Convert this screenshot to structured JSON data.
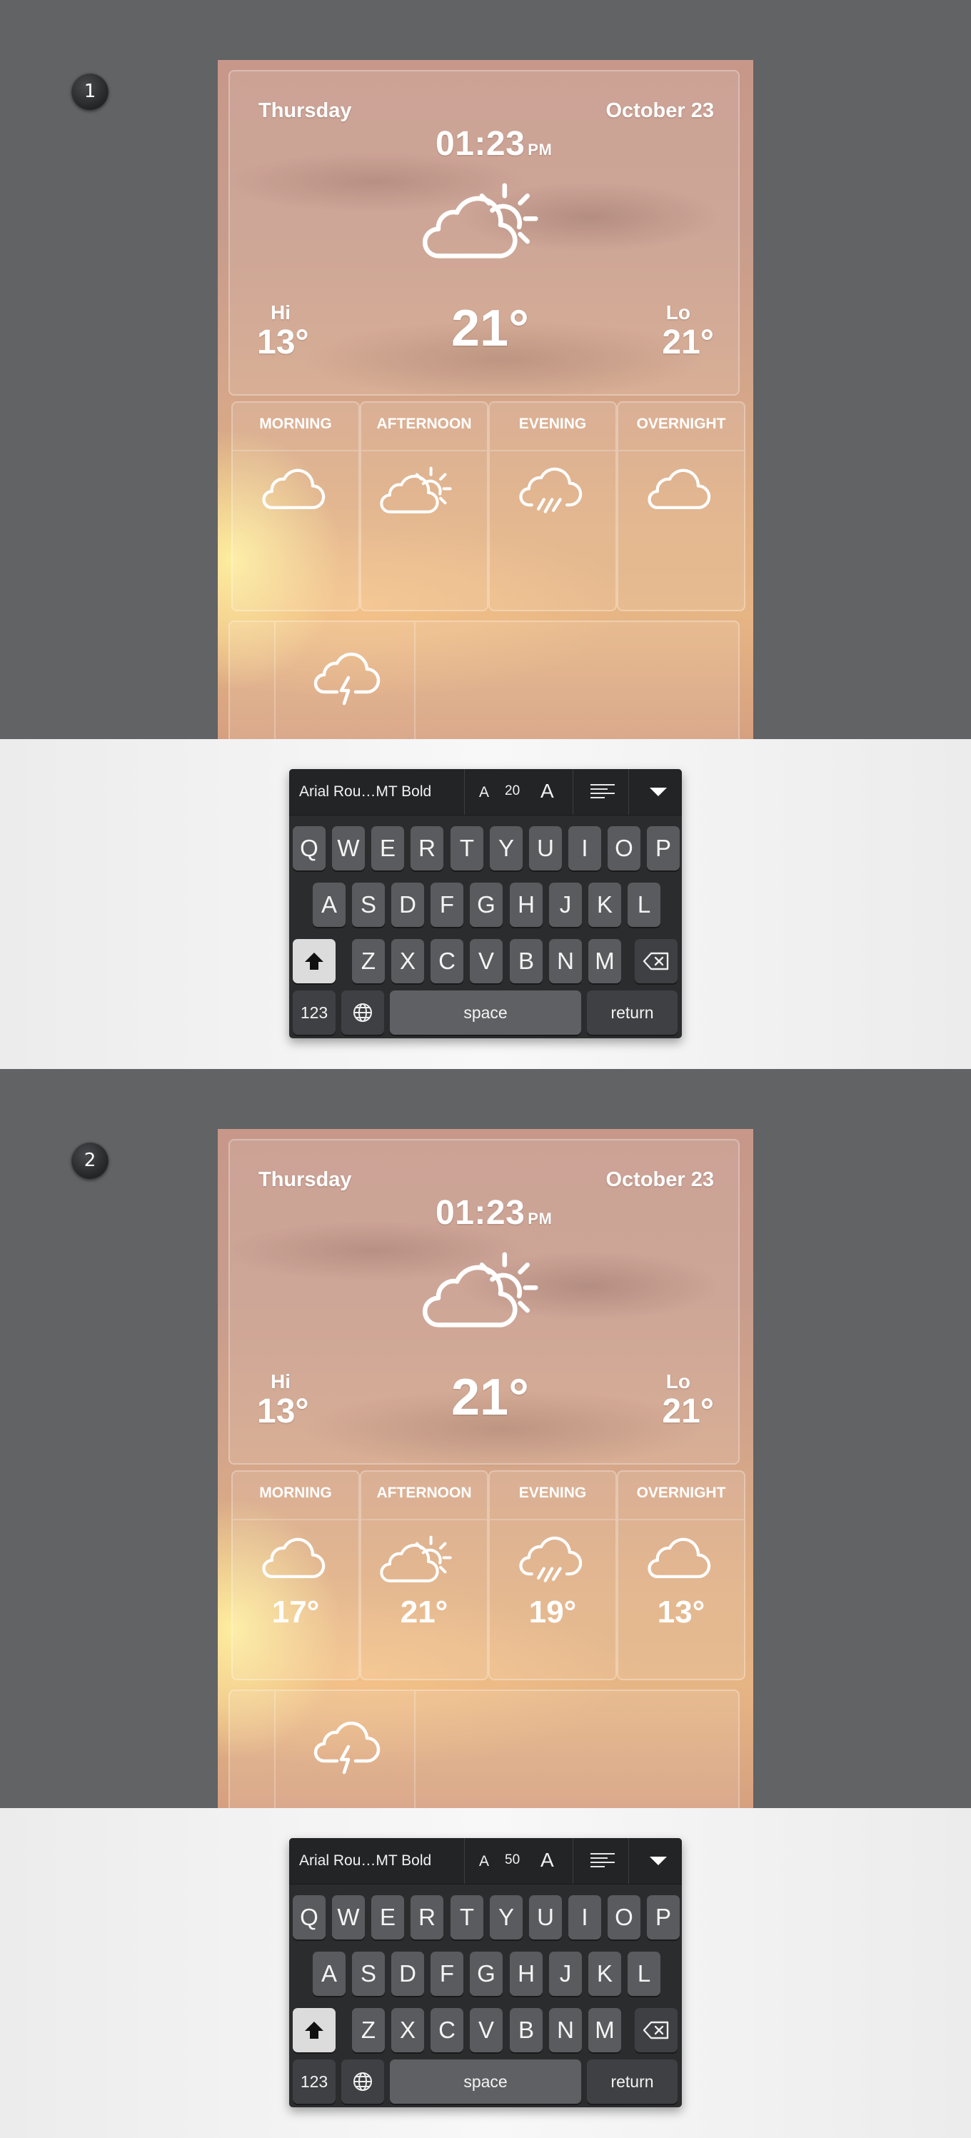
{
  "steps": [
    {
      "number": "1",
      "weather": {
        "day": "Thursday",
        "date": "October 23",
        "time": "01:23",
        "ampm": "PM",
        "condition_icon": "partly-cloudy-icon",
        "hi_label": "Hi",
        "hi_value": "13°",
        "lo_label": "Lo",
        "lo_value": "21°",
        "current_temp": "21°",
        "slots": [
          {
            "title": "MORNING",
            "icon": "cloud-icon",
            "temp": ""
          },
          {
            "title": "AFTERNOON",
            "icon": "partly-cloudy-icon",
            "temp": ""
          },
          {
            "title": "EVENING",
            "icon": "rain-cloud-icon",
            "temp": ""
          },
          {
            "title": "OVERNIGHT",
            "icon": "cloud-icon",
            "temp": ""
          }
        ],
        "bottom_icon": "thunderstorm-icon"
      },
      "keyboard": {
        "font_name": "Arial Rou…MT Bold",
        "size_small_a": "A",
        "font_size": "20",
        "size_big_a": "A"
      }
    },
    {
      "number": "2",
      "weather": {
        "day": "Thursday",
        "date": "October 23",
        "time": "01:23",
        "ampm": "PM",
        "condition_icon": "partly-cloudy-icon",
        "hi_label": "Hi",
        "hi_value": "13°",
        "lo_label": "Lo",
        "lo_value": "21°",
        "current_temp": "21°",
        "slots": [
          {
            "title": "MORNING",
            "icon": "cloud-icon",
            "temp": "17°"
          },
          {
            "title": "AFTERNOON",
            "icon": "partly-cloudy-icon",
            "temp": "21°"
          },
          {
            "title": "EVENING",
            "icon": "rain-cloud-icon",
            "temp": "19°"
          },
          {
            "title": "OVERNIGHT",
            "icon": "cloud-icon",
            "temp": "13°"
          }
        ],
        "bottom_icon": "thunderstorm-icon"
      },
      "keyboard": {
        "font_name": "Arial Rou…MT Bold",
        "size_small_a": "A",
        "font_size": "50",
        "size_big_a": "A"
      }
    }
  ],
  "keys": {
    "row1": [
      "Q",
      "W",
      "E",
      "R",
      "T",
      "Y",
      "U",
      "I",
      "O",
      "P"
    ],
    "row2": [
      "A",
      "S",
      "D",
      "F",
      "G",
      "H",
      "J",
      "K",
      "L"
    ],
    "row3": [
      "Z",
      "X",
      "C",
      "V",
      "B",
      "N",
      "M"
    ],
    "numbers": "123",
    "space": "space",
    "return": "return"
  },
  "colors": {
    "page_dark": "#626365",
    "keyboard": "#2b2c2e",
    "key": "#5a5b5e"
  }
}
